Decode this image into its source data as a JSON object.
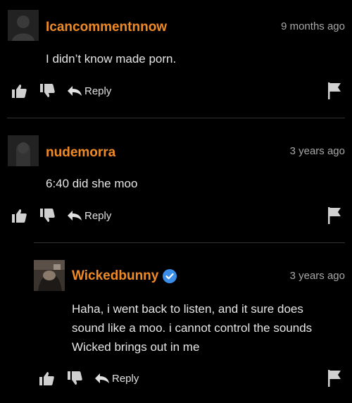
{
  "comments": [
    {
      "username": "Icancommentnnow",
      "timestamp": "9 months ago",
      "text": "I didn’t know made porn.",
      "reply_label": "Reply",
      "verified": false
    },
    {
      "username": "nudemorra",
      "timestamp": "3 years ago",
      "text": "6:40 did she moo",
      "reply_label": "Reply",
      "verified": false
    },
    {
      "username": "Wickedbunny",
      "timestamp": "3 years ago",
      "text": "Haha, i went back to listen, and it sure does sound like a moo. i cannot control the sounds Wicked brings out in me",
      "reply_label": "Reply",
      "verified": true
    }
  ],
  "colors": {
    "background": "#000000",
    "username": "#f08a24",
    "verified_badge": "#3b8ee8",
    "text": "#e6e6e6",
    "muted": "#a8a8a8"
  },
  "icons": [
    "user-avatar-icon",
    "thumbs-up-icon",
    "thumbs-down-icon",
    "reply-arrow-icon",
    "flag-icon",
    "verified-badge-icon"
  ]
}
